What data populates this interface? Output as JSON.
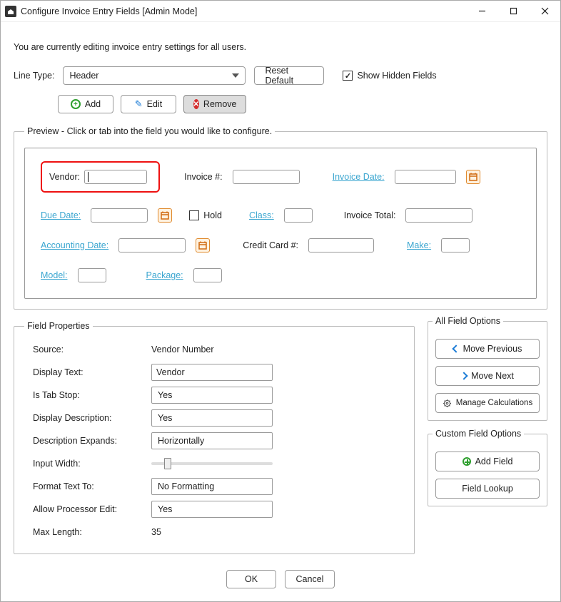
{
  "window": {
    "title": "Configure Invoice Entry Fields [Admin Mode]"
  },
  "info_text": "You are currently editing invoice entry settings for all users.",
  "line_type": {
    "label": "Line Type:",
    "selected": "Header"
  },
  "reset_default": "Reset Default",
  "show_hidden": {
    "label": "Show Hidden Fields",
    "checked": true
  },
  "toolbar_buttons": {
    "add": "Add",
    "edit": "Edit",
    "remove": "Remove"
  },
  "preview": {
    "legend": "Preview - Click or tab into the field you would like to configure.",
    "fields": {
      "vendor": "Vendor:",
      "invoice_no": "Invoice #:",
      "invoice_date": "Invoice Date:",
      "due_date": "Due Date:",
      "hold": "Hold",
      "class": "Class:",
      "invoice_total": "Invoice Total:",
      "accounting_date": "Accounting Date:",
      "credit_card_no": "Credit Card #:",
      "make": "Make:",
      "model": "Model:",
      "package": "Package:"
    }
  },
  "field_properties": {
    "legend": "Field Properties",
    "source": {
      "label": "Source:",
      "value": "Vendor Number"
    },
    "display_text": {
      "label": "Display Text:",
      "value": "Vendor"
    },
    "is_tab_stop": {
      "label": "Is Tab Stop:",
      "value": "Yes"
    },
    "display_description": {
      "label": "Display Description:",
      "value": "Yes"
    },
    "description_expands": {
      "label": "Description Expands:",
      "value": "Horizontally"
    },
    "input_width": {
      "label": "Input Width:"
    },
    "format_text_to": {
      "label": "Format Text To:",
      "value": "No Formatting"
    },
    "allow_processor_edit": {
      "label": "Allow Processor Edit:",
      "value": "Yes"
    },
    "max_length": {
      "label": "Max Length:",
      "value": "35"
    }
  },
  "all_field_options": {
    "legend": "All Field Options",
    "move_previous": "Move Previous",
    "move_next": "Move Next",
    "manage_calculations": "Manage Calculations"
  },
  "custom_field_options": {
    "legend": "Custom Field Options",
    "add_field": "Add Field",
    "field_lookup": "Field Lookup"
  },
  "footer": {
    "ok": "OK",
    "cancel": "Cancel"
  }
}
